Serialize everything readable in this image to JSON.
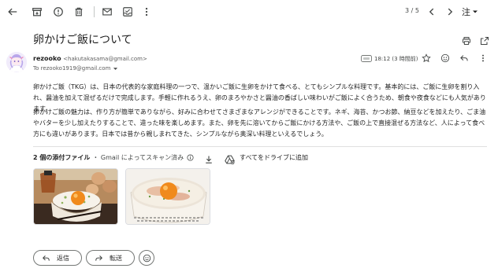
{
  "toolbar": {
    "counter": "3 / 5",
    "language_button": "注",
    "icons": [
      "back-arrow-icon",
      "archive-icon",
      "report-spam-icon",
      "delete-icon",
      "mark-unread-icon",
      "move-to-icon",
      "more-vert-icon",
      "prev-icon",
      "next-icon"
    ]
  },
  "message": {
    "subject": "卵かけご飯について",
    "sender_name": "rezooko",
    "sender_email": "<hakutakasama@gmail.com>",
    "to": "To rezooko1919@gmail.com",
    "time": "18:12 (3 時間前)",
    "body": [
      "卵かけご飯（TKG）は、日本の代表的な家庭料理の一つで、温かいご飯に生卵をかけて食べる、とてもシンプルな料理です。基本的には、ご飯に生卵を割り入れ、醤油を加えて混ぜるだけで完成します。手軽に作れるうえ、卵のまろやかさと醤油の香ばしい味わいがご飯によく合うため、朝食や夜食などにも人気があります。",
      "卵かけご飯の魅力は、作り方が簡単でありながら、好みに合わせてさまざまなアレンジができることです。ネギ、海苔、かつお節、納豆などを加えたり、ごま油やバターを少し加えたりすることで、違った味を楽しめます。また、卵を先に溶いてからご飯にかける方法や、ご飯の上で直接混ぜる方法など、人によって食べ方にも違いがあります。日本では昔から親しまれてきた、シンプルながら奥深い料理といえるでしょう。"
    ]
  },
  "attachments": {
    "title": "2 個の添付ファイル",
    "scan_note": "・ Gmail によってスキャン済み",
    "drive_label": "すべてをドライブに追加",
    "count": 2
  },
  "actions": {
    "reply_label": "返信",
    "forward_label": "転送"
  },
  "colors": {
    "text": "#1f1f1f",
    "secondary": "#444746",
    "border": "#747775",
    "yolk": "#f08a1c"
  }
}
